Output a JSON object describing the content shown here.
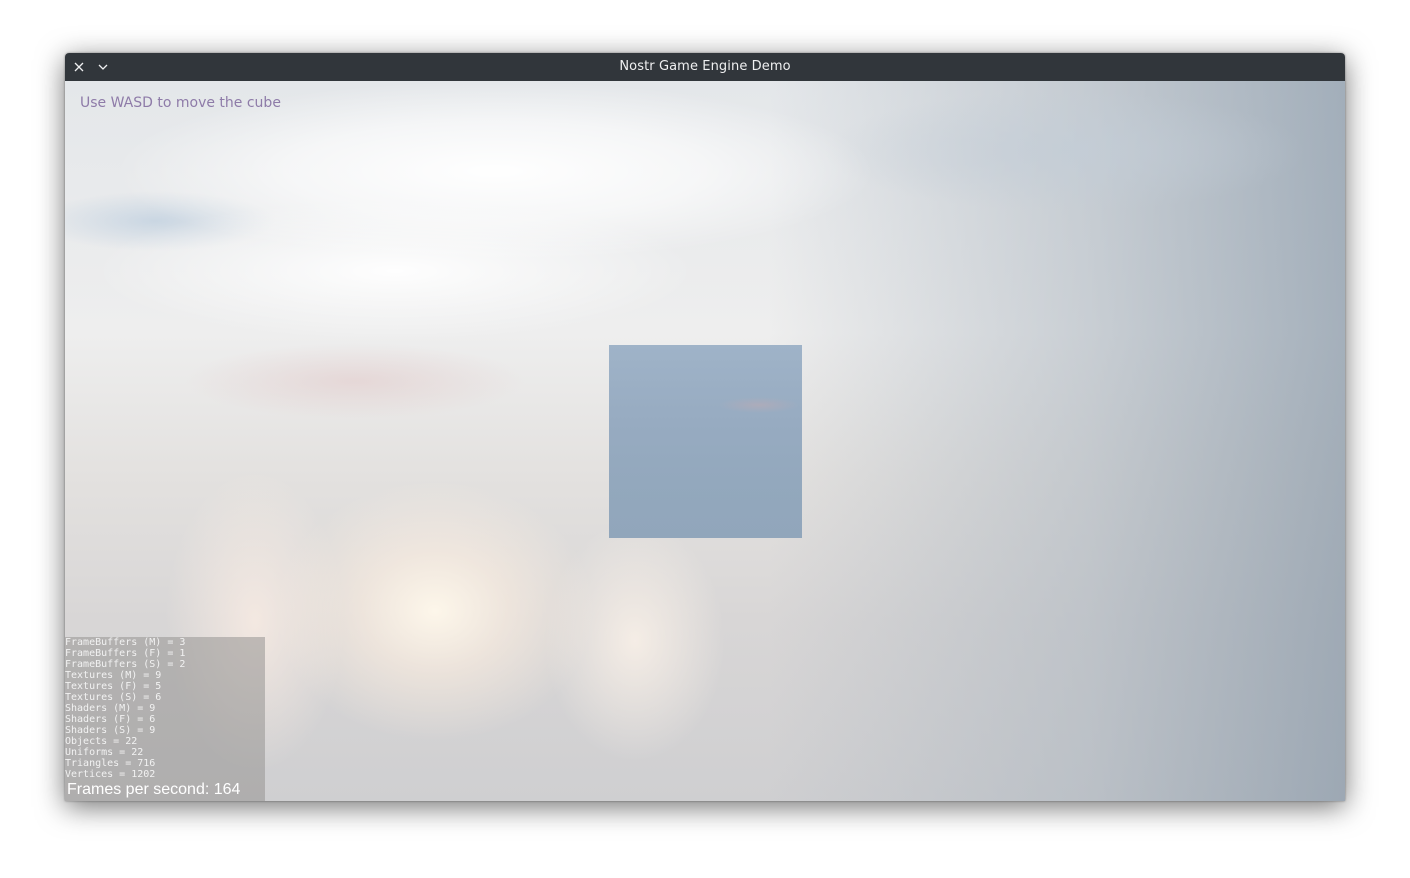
{
  "window": {
    "title": "Nostr Game Engine Demo",
    "close_icon": "close-icon",
    "menu_icon": "chevron-down-icon"
  },
  "scene": {
    "hint_text": "Use WASD to move the cube",
    "hint_color": "#8e7ba8",
    "cube_color": "#97abc1"
  },
  "stats": {
    "lines": [
      "FrameBuffers (M) = 3",
      "FrameBuffers (F) = 1",
      "FrameBuffers (S) = 2",
      "Textures (M) = 9",
      "Textures (F) = 5",
      "Textures (S) = 6",
      "Shaders (M) = 9",
      "Shaders (F) = 6",
      "Shaders (S) = 9",
      "Objects = 22",
      "Uniforms = 22",
      "Triangles = 716",
      "Vertices = 1202"
    ],
    "fps": "Frames per second: 164"
  }
}
